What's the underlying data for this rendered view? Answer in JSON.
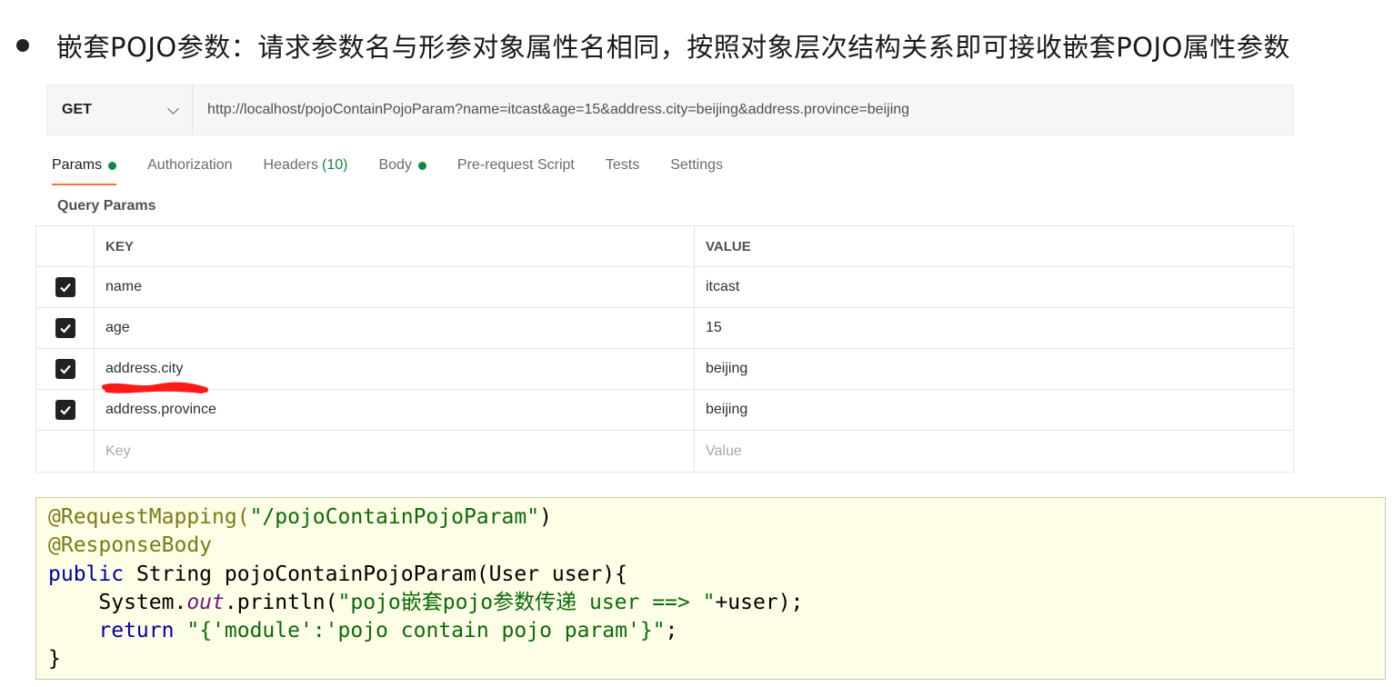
{
  "heading": "嵌套POJO参数：请求参数名与形参对象属性名相同，按照对象层次结构关系即可接收嵌套POJO属性参数",
  "request": {
    "method": "GET",
    "url": "http://localhost/pojoContainPojoParam?name=itcast&age=15&address.city=beijing&address.province=beijing"
  },
  "tabs": [
    {
      "label": "Params",
      "active": true,
      "dot": true
    },
    {
      "label": "Authorization"
    },
    {
      "label": "Headers",
      "count": "(10)"
    },
    {
      "label": "Body",
      "dot": true
    },
    {
      "label": "Pre-request Script"
    },
    {
      "label": "Tests"
    },
    {
      "label": "Settings"
    }
  ],
  "query_params_title": "Query Params",
  "table": {
    "headers": {
      "key": "KEY",
      "value": "VALUE"
    },
    "rows": [
      {
        "key": "name",
        "value": "itcast",
        "checked": true
      },
      {
        "key": "age",
        "value": "15",
        "checked": true
      },
      {
        "key": "address.city",
        "value": "beijing",
        "checked": true
      },
      {
        "key": "address.province",
        "value": "beijing",
        "checked": true
      }
    ],
    "placeholder": {
      "key": "Key",
      "value": "Value"
    }
  },
  "code": {
    "l1_ann": "@RequestMapping(",
    "l1_str": "\"/pojoContainPojoParam\"",
    "l1_end": ")",
    "l2_ann": "@ResponseBody",
    "l3_kw": "public",
    "l3_rest": " String pojoContainPojoParam(User user){",
    "l4_a": "    System.",
    "l4_field": "out",
    "l4_b": ".println(",
    "l4_str": "\"pojo嵌套pojo参数传递 user ==> \"",
    "l4_c": "+user);",
    "l5_indent": "    ",
    "l5_kw": "return",
    "l5_sp": " ",
    "l5_str": "\"{'module':'pojo contain pojo param'}\"",
    "l5_end": ";",
    "l6": "}"
  },
  "colors": {
    "accent": "#ff6c37",
    "dot": "#0c8a43",
    "code_bg": "#fefee6",
    "annotation_underline": "#ff0000"
  }
}
